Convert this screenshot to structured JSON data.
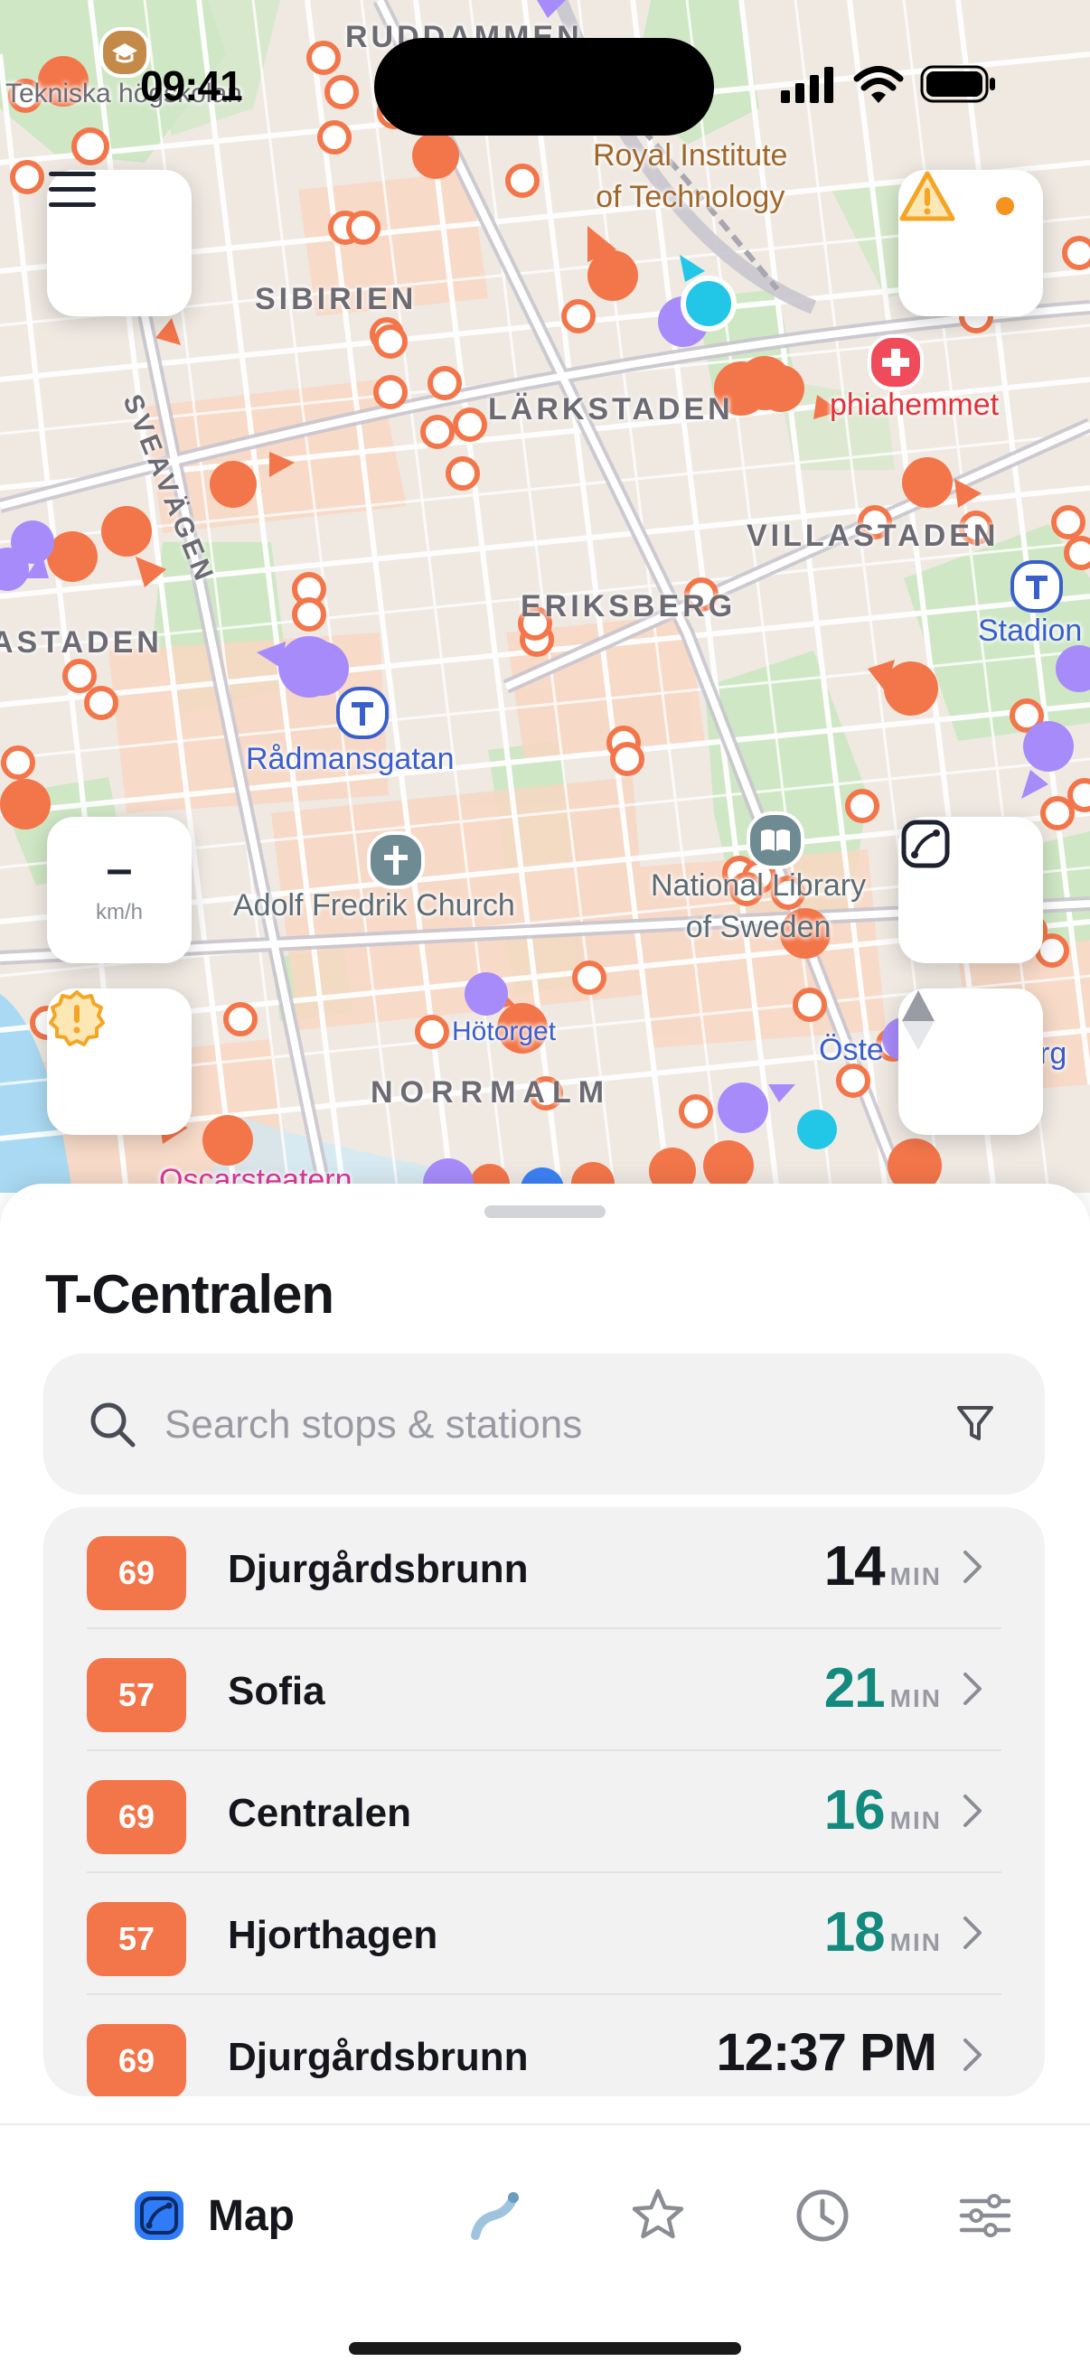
{
  "status_bar": {
    "time": "09:41"
  },
  "map": {
    "areas": [
      "RUDDAMMEN",
      "SIBIRIEN",
      "LÄRKSTADEN",
      "VILLASTADEN",
      "ASTADEN",
      "ERIKSBERG",
      "NORRMALM",
      "SVEAVÄGEN"
    ],
    "pois": {
      "royal_institute": "Royal Institute\nof Technology",
      "sophiahemmet": "phiahemmet",
      "stadion": "Stadion",
      "radmansgatan": "Rådmansgatan",
      "adolf_fredrik": "Adolf Fredrik Church",
      "national_library": "National Library\nof Sweden",
      "ostermalm": "Öste",
      "ostermalm_tail": "rg",
      "oscarsteatern": "Oscarsteatern",
      "hogskolan": "Tekniska högskolan",
      "hotorget": "Hötorget"
    },
    "speed": {
      "value": "–",
      "unit": "km/h"
    },
    "accent": "#f3764a",
    "purple": "#a78bfa",
    "alert_color": "#f5a524"
  },
  "sheet": {
    "title": "T-Centralen",
    "search_placeholder": "Search stops & stations",
    "departures": [
      {
        "line": "69",
        "destination": "Djurgårdsbrunn",
        "time": "14",
        "unit": "MIN",
        "color": "#15161c"
      },
      {
        "line": "57",
        "destination": "Sofia",
        "time": "21",
        "unit": "MIN",
        "color": "#138a7e"
      },
      {
        "line": "69",
        "destination": "Centralen",
        "time": "16",
        "unit": "MIN",
        "color": "#138a7e"
      },
      {
        "line": "57",
        "destination": "Hjorthagen",
        "time": "18",
        "unit": "MIN",
        "color": "#138a7e"
      },
      {
        "line": "69",
        "destination": "Djurgårdsbrunn",
        "time": "12:37 PM",
        "unit": "",
        "color": "#15161c"
      }
    ]
  },
  "tabbar": {
    "tabs": [
      {
        "label": "Map",
        "icon": "map-icon",
        "active": true
      },
      {
        "label": "",
        "icon": "route-icon",
        "active": false
      },
      {
        "label": "",
        "icon": "star-icon",
        "active": false
      },
      {
        "label": "",
        "icon": "clock-icon",
        "active": false
      },
      {
        "label": "",
        "icon": "sliders-icon",
        "active": false
      }
    ]
  }
}
